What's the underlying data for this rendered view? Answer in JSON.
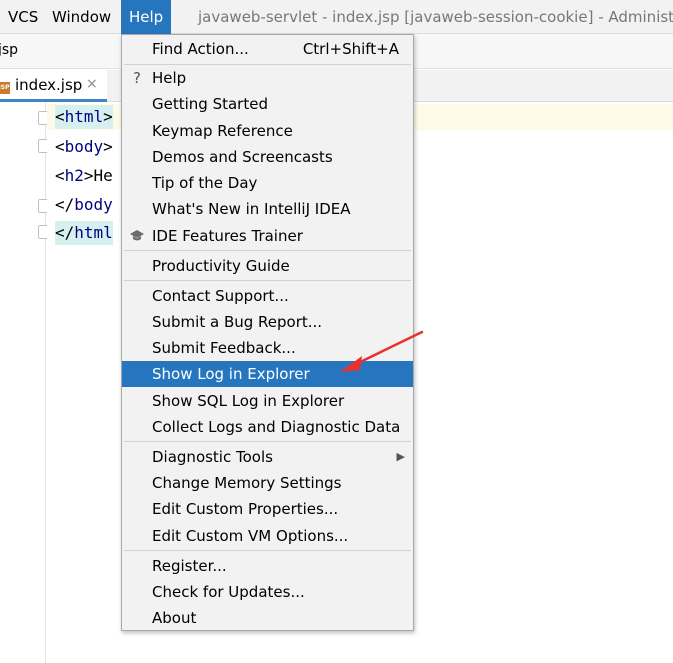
{
  "menubar": {
    "items": [
      "VCS",
      "Window",
      "Help"
    ],
    "title": "javaweb-servlet - index.jsp [javaweb-session-cookie] - Administra"
  },
  "navbar": {
    "crumb": "jsp"
  },
  "tab": {
    "badge": "JSP",
    "name": "index.jsp",
    "close": "×"
  },
  "editor": {
    "lines": [
      {
        "open": "<",
        "tag": "html",
        "close": ">"
      },
      {
        "open": "<",
        "tag": "body",
        "close": ">"
      },
      {
        "open": "<",
        "tag": "h2",
        "close": ">He"
      },
      {
        "open": "</",
        "tag": "body",
        "close": ""
      },
      {
        "open": "</",
        "tag": "html",
        "close": ""
      }
    ]
  },
  "menu": {
    "find_action": {
      "label": "Find Action...",
      "shortcut": "Ctrl+Shift+A"
    },
    "help": {
      "label": "Help",
      "icon": "?"
    },
    "getting_started": "Getting Started",
    "keymap_reference": "Keymap Reference",
    "demos": "Demos and Screencasts",
    "tip": "Tip of the Day",
    "whats_new": "What's New in IntelliJ IDEA",
    "ide_trainer": "IDE Features Trainer",
    "productivity": "Productivity Guide",
    "contact_support": "Contact Support...",
    "submit_bug": "Submit a Bug Report...",
    "submit_feedback": "Submit Feedback...",
    "show_log": "Show Log in Explorer",
    "show_sql_log": "Show SQL Log in Explorer",
    "collect_logs": "Collect Logs and Diagnostic Data",
    "diagnostic_tools": "Diagnostic Tools",
    "change_memory": "Change Memory Settings",
    "edit_properties": "Edit Custom Properties...",
    "edit_vm": "Edit Custom VM Options...",
    "register": "Register...",
    "check_updates": "Check for Updates...",
    "about": "About"
  },
  "colors": {
    "selection": "#2675bf",
    "annotation_arrow": "#e8322d"
  }
}
